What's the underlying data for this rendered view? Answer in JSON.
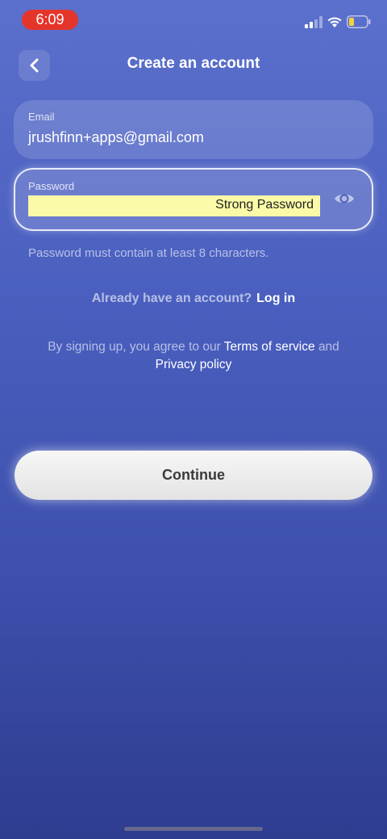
{
  "status_bar": {
    "time": "6:09",
    "icons": [
      "signal-icon",
      "wifi-icon",
      "battery-icon"
    ],
    "time_pill_color": "#e5352b"
  },
  "header": {
    "title": "Create an account",
    "back_icon": "chevron-left-icon"
  },
  "form": {
    "email": {
      "label": "Email",
      "value": "jrushfinn+apps@gmail.com"
    },
    "password": {
      "label": "Password",
      "autofill_text": "Strong Password",
      "toggle_icon": "eye-icon",
      "autofill_color": "#fafaa8"
    },
    "hint": "Password must contain at least 8 characters."
  },
  "login": {
    "question": "Already have an account?",
    "link": "Log in"
  },
  "terms": {
    "prefix": "By signing up, you agree to our",
    "terms_link": "Terms of service",
    "and": "and",
    "privacy_link": "Privacy policy"
  },
  "continue_button": {
    "label": "Continue"
  }
}
